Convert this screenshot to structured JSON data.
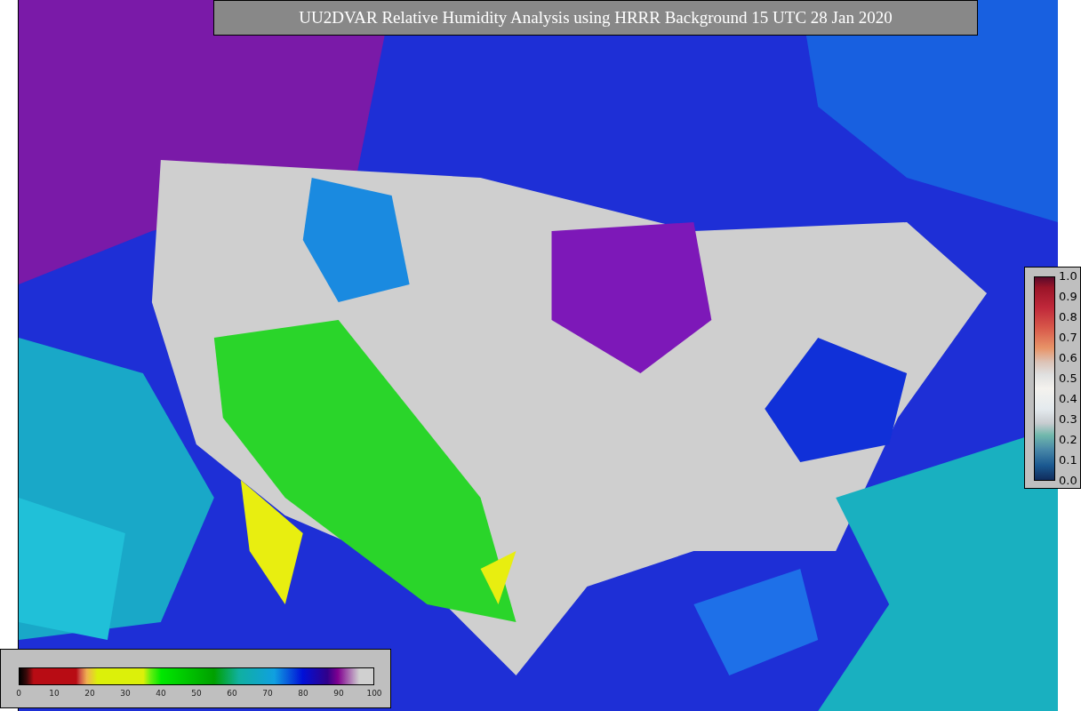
{
  "title": "UU2DVAR Relative Humidity Analysis using HRRR Background 15 UTC 28 Jan 2020",
  "humidity_colorbar": {
    "ticks": [
      "0",
      "10",
      "20",
      "30",
      "40",
      "50",
      "60",
      "70",
      "80",
      "90",
      "100"
    ]
  },
  "observation_colorbar": {
    "ticks": [
      "1.0",
      "0.9",
      "0.8",
      "0.7",
      "0.6",
      "0.5",
      "0.4",
      "0.3",
      "0.2",
      "0.1",
      "0.0"
    ]
  }
}
